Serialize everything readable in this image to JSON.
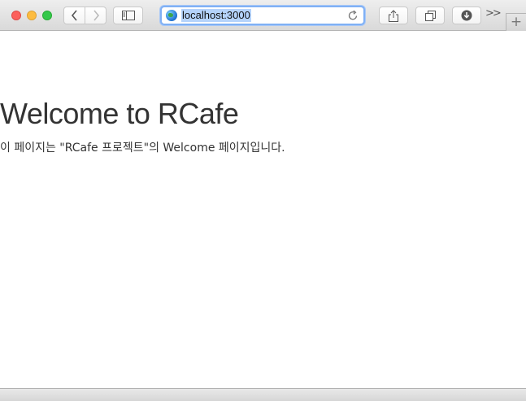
{
  "browser": {
    "address_bar": {
      "url": "localhost:3000"
    },
    "icons": {
      "back": "chevron-left-icon",
      "forward": "chevron-right-icon",
      "sidebar": "sidebar-icon",
      "site": "globe-icon",
      "reload": "reload-icon",
      "share": "share-icon",
      "tabs": "tab-overview-icon",
      "downloads": "download-icon",
      "overflow": "double-chevron-icon",
      "new_tab": "plus-icon"
    },
    "overflow_label": ">>",
    "new_tab_label": "+",
    "colors": {
      "close": "#fc605c",
      "minimize": "#fdbc40",
      "zoom": "#34c84a",
      "url_highlight": "#b5d3fb"
    }
  },
  "page": {
    "heading": "Welcome to RCafe",
    "description": "이 페이지는 \"RCafe 프로젝트\"의 Welcome 페이지입니다."
  }
}
